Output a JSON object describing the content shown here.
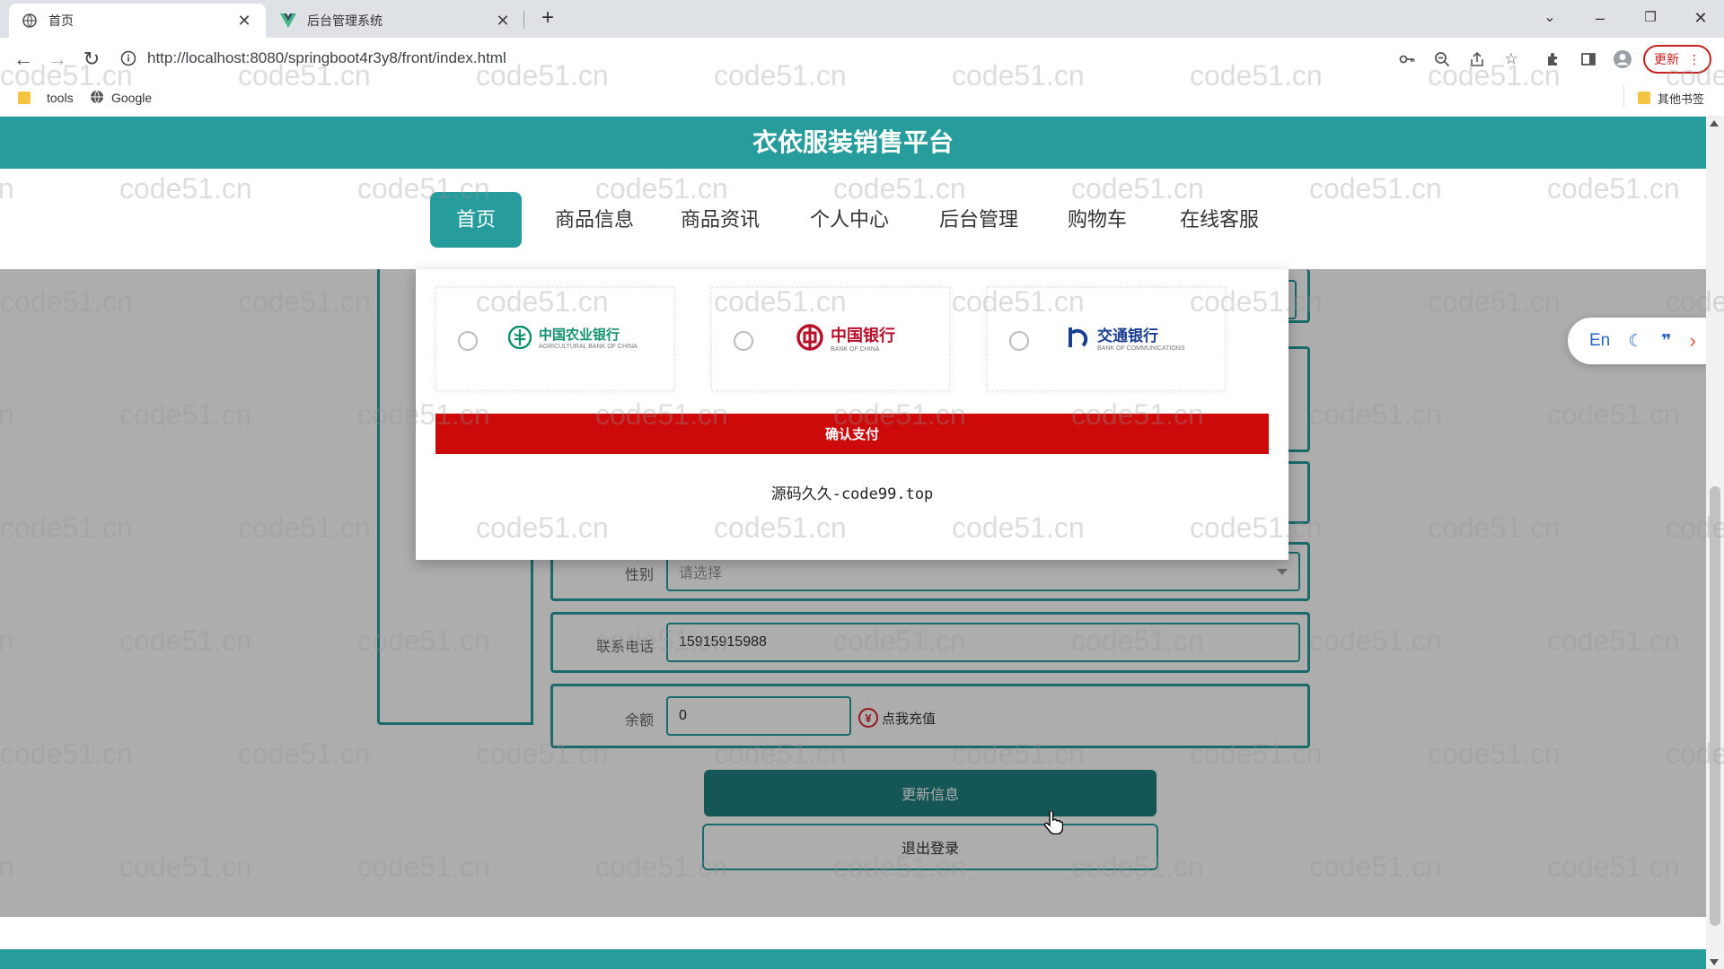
{
  "browser": {
    "tabs": [
      {
        "title": "首页",
        "active": true
      },
      {
        "title": "后台管理系统",
        "active": false
      }
    ],
    "url": "http://localhost:8080/springboot4r3y8/front/index.html",
    "update_label": "更新",
    "bookmarks": [
      {
        "label": "tools"
      },
      {
        "label": "Google"
      }
    ],
    "other_bookmarks_label": "其他书签"
  },
  "site": {
    "title": "衣依服装销售平台",
    "nav": [
      "首页",
      "商品信息",
      "商品资讯",
      "个人中心",
      "后台管理",
      "购物车",
      "在线客服"
    ],
    "active_nav": "首页"
  },
  "form": {
    "gender_label": "性别",
    "gender_placeholder": "请选择",
    "phone_label": "联系电话",
    "phone_value": "15915915988",
    "balance_label": "余额",
    "balance_value": "0",
    "recharge_label": "点我充值",
    "update_button": "更新信息",
    "logout_button": "退出登录"
  },
  "payment_modal": {
    "banks": [
      {
        "name": "中国农业银行",
        "sub": "AGRICULTURAL BANK OF CHINA",
        "color": "#13906f"
      },
      {
        "name": "中国银行",
        "sub": "BANK OF CHINA",
        "color": "#b7102b"
      },
      {
        "name": "交通银行",
        "sub": "BANK OF COMMUNICATIONS",
        "color": "#1b3f8f"
      }
    ],
    "confirm_button": "确认支付",
    "footer_text": "源码久久-code99.top"
  },
  "translate_widget": {
    "lang_label": "En"
  },
  "watermark": "code51.cn",
  "colors": {
    "primary": "#279c9c",
    "confirm_red": "#cc0a0a"
  }
}
